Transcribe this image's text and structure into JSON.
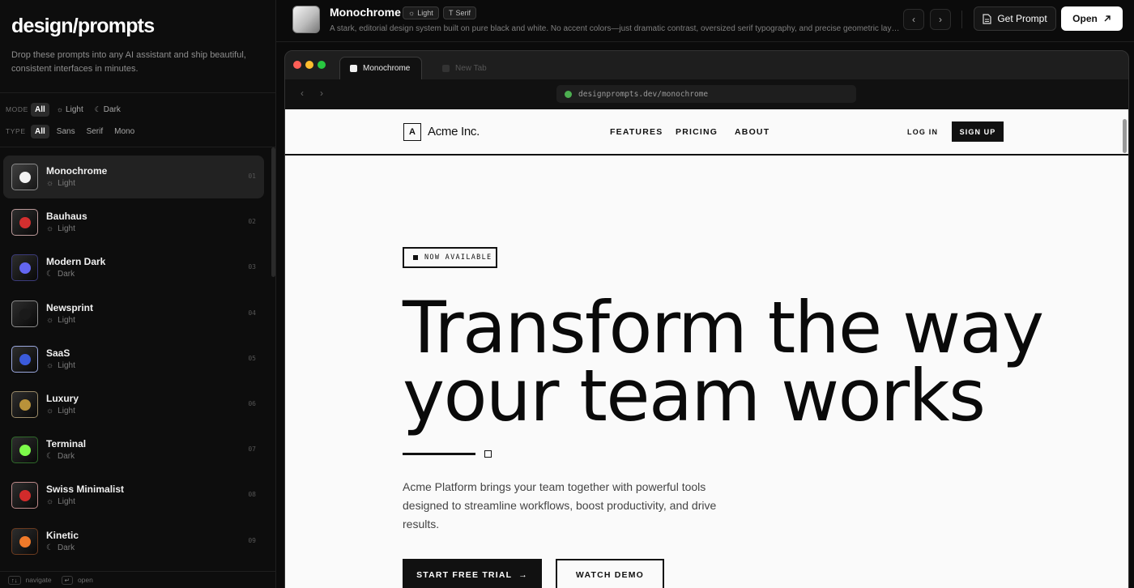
{
  "sidebar": {
    "brand": "design/prompts",
    "tagline": "Drop these prompts into any AI assistant and ship beautiful, consistent interfaces in minutes.",
    "mode_label": "MODE",
    "mode_options": [
      "All",
      "Light",
      "Dark"
    ],
    "type_label": "TYPE",
    "type_options": [
      "All",
      "Sans",
      "Serif",
      "Mono"
    ],
    "items": [
      {
        "name": "Monochrome",
        "mode": "Light",
        "num": "01",
        "color": "#f2f2f2",
        "ring": "#8a8a8a"
      },
      {
        "name": "Bauhaus",
        "mode": "Light",
        "num": "02",
        "color": "#d32f2f",
        "ring": "#b99"
      },
      {
        "name": "Modern Dark",
        "mode": "Dark",
        "num": "03",
        "color": "#6366f1",
        "ring": "#3b3b7a"
      },
      {
        "name": "Newsprint",
        "mode": "Light",
        "num": "04",
        "color": "#1a1a1a",
        "ring": "#8c8c8c"
      },
      {
        "name": "SaaS",
        "mode": "Light",
        "num": "05",
        "color": "#3b5bdb",
        "ring": "#9aa7dd"
      },
      {
        "name": "Luxury",
        "mode": "Light",
        "num": "06",
        "color": "#b8923a",
        "ring": "#9a8a68"
      },
      {
        "name": "Terminal",
        "mode": "Dark",
        "num": "07",
        "color": "#7dfc4a",
        "ring": "#2f6a2a"
      },
      {
        "name": "Swiss Minimalist",
        "mode": "Light",
        "num": "08",
        "color": "#d12b2b",
        "ring": "#b88"
      },
      {
        "name": "Kinetic",
        "mode": "Dark",
        "num": "09",
        "color": "#f07a2a",
        "ring": "#6a3a1f"
      }
    ],
    "footer": {
      "navigate_key": "↑↓",
      "navigate": "navigate",
      "open_key": "↵",
      "open": "open"
    }
  },
  "topbar": {
    "title": "Monochrome",
    "tag_mode": "Light",
    "tag_type": "Serif",
    "description": "A stark, editorial design system built on pure black and white. No accent colors—just dramatic contrast, oversized serif typography, and precise geometric layou...",
    "get_prompt": "Get Prompt",
    "open": "Open"
  },
  "browser": {
    "tab_active": "Monochrome",
    "tab_idle": "New Tab",
    "url": "designprompts.dev/monochrome"
  },
  "site": {
    "logo_letter": "A",
    "logo_text": "Acme Inc.",
    "nav": [
      "FEATURES",
      "PRICING",
      "ABOUT"
    ],
    "login": "LOG IN",
    "signup": "SIGN UP",
    "badge": "NOW AVAILABLE",
    "headline_1": "Transform the way",
    "headline_2": "your team works",
    "subtext": "Acme Platform brings your team together with powerful tools designed to streamline workflows, boost productivity, and drive results.",
    "cta_primary": "START FREE TRIAL",
    "cta_secondary": "WATCH DEMO"
  }
}
